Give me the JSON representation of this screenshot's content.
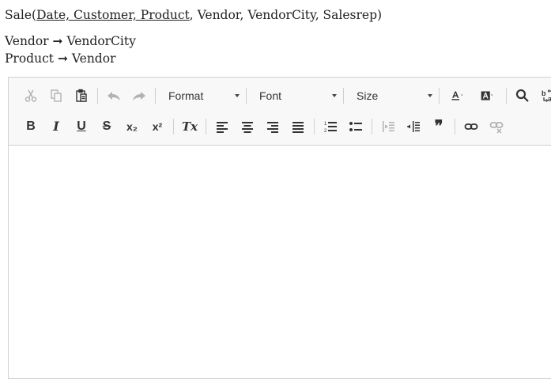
{
  "schema": {
    "relation": "Sale",
    "open": "(",
    "keys": "Date, Customer, Product",
    "rest": ", Vendor, VendorCity, Salesrep)"
  },
  "fds": [
    {
      "lhs": "Vendor",
      "arrow": "➞",
      "rhs": "VendorCity"
    },
    {
      "lhs": "Product",
      "arrow": "➞",
      "rhs": "Vendor"
    }
  ],
  "toolbar": {
    "format_label": "Format",
    "font_label": "Font",
    "size_label": "Size",
    "bold_glyph": "B",
    "italic_glyph": "I",
    "underline_glyph": "U",
    "strike_glyph": "S",
    "subscript_glyph": "x₂",
    "superscript_glyph": "x²",
    "removeformat_glyph": "Tx",
    "blockquote_glyph": "❞"
  },
  "colors": {
    "toolbar_bg": "#f8f8f8",
    "border": "#d1d1d1",
    "icon": "#333333"
  }
}
